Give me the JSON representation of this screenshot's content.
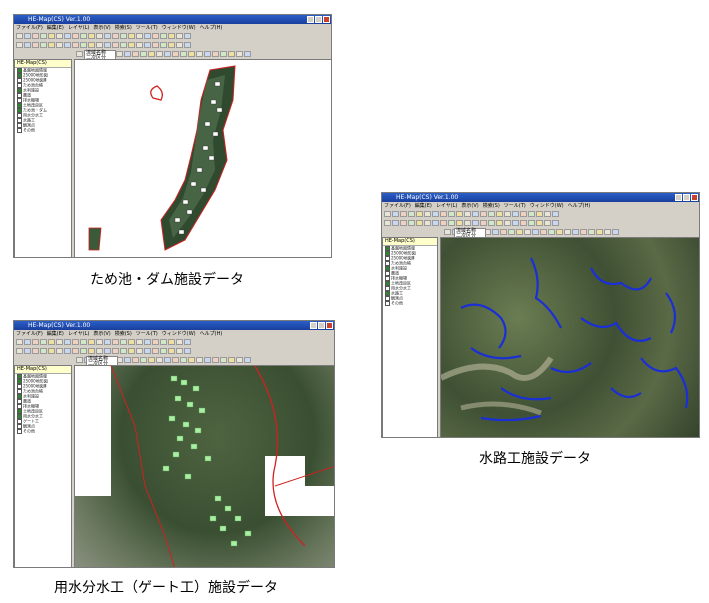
{
  "screenshots": [
    {
      "window_title": "HE-Map(CS) Ver.1.00",
      "menus": [
        "ファイル(F)",
        "編集(E)",
        "レイヤ(L)",
        "表示(V)",
        "検索(S)",
        "ツール(T)",
        "ウィンドウ(W)",
        "ヘルプ(H)"
      ],
      "map_info": "流域名称\n二次区分",
      "sidebar_title": "HE-Map(CS)",
      "tree_items": [
        "基盤地図情報",
        "25000地形図",
        "25000地図Ⅲ",
        "ため池台帳",
        "水利施設",
        "農道",
        "排水機場",
        "土地改良区",
        "ため池・ダム",
        "用水分水工",
        "水路工",
        "観測点",
        "その他"
      ],
      "caption": "ため池・ダム施設データ"
    },
    {
      "window_title": "HE-Map(CS) Ver.1.00",
      "menus": [
        "ファイル(F)",
        "編集(E)",
        "レイヤ(L)",
        "表示(V)",
        "検索(S)",
        "ツール(T)",
        "ウィンドウ(W)",
        "ヘルプ(H)"
      ],
      "map_info": "流域名称\n二次区分",
      "sidebar_title": "HE-Map(CS)",
      "tree_items": [
        "基盤地図情報",
        "25000地形図",
        "25000地図Ⅲ",
        "ため池台帳",
        "水利施設",
        "農道",
        "排水機場",
        "土地改良区",
        "用水分水工",
        "水路工",
        "観測点",
        "その他"
      ],
      "caption": "水路工施設データ"
    },
    {
      "window_title": "HE-Map(CS) Ver.1.00",
      "menus": [
        "ファイル(F)",
        "編集(E)",
        "レイヤ(L)",
        "表示(V)",
        "検索(S)",
        "ツール(T)",
        "ウィンドウ(W)",
        "ヘルプ(H)"
      ],
      "map_info": "流域名称\n二次区分",
      "sidebar_title": "HE-Map(CS)",
      "tree_items": [
        "基盤地図情報",
        "25000地形図",
        "25000地図Ⅲ",
        "ため池台帳",
        "水利施設",
        "農道",
        "排水機場",
        "土地改良区",
        "用水分水工",
        "ゲート工",
        "観測点",
        "その他"
      ],
      "caption": "用水分水工（ゲート工）施設データ"
    }
  ],
  "colors": {
    "title_bar": "#1a3f9e",
    "toolbar_bg": "#d4d0c8",
    "boundary_red": "#d02020",
    "waterway_blue": "#1a2fd6",
    "gate_green": "#a8f0a0"
  }
}
